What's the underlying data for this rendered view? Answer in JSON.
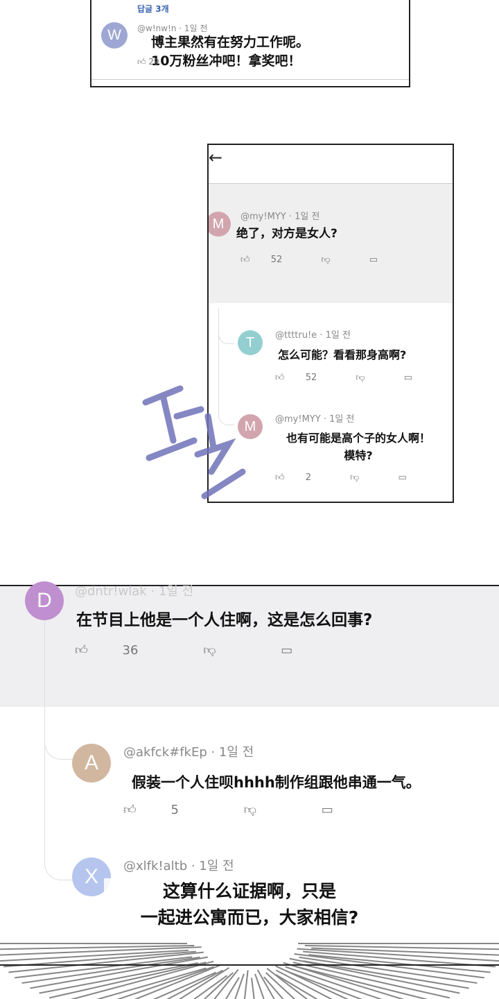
{
  "panel1": {
    "replies_link": "답글 3개",
    "avatar_letter": "W",
    "avatar_color": "#9ea7d3",
    "meta": "@w!nw!n · 1일 전",
    "text_line1": "博主果然有在努力工作呢。",
    "text_line2": "10万粉丝冲吧！拿奖吧！",
    "likes": "29"
  },
  "panel2": {
    "back_icon": "←",
    "comment": {
      "avatar_letter": "M",
      "avatar_color": "#d2a5ae",
      "meta": "@my!MYY · 1일 전",
      "text": "绝了，对方是女人?",
      "likes": "52"
    },
    "reply1": {
      "avatar_letter": "T",
      "avatar_color": "#93cfd0",
      "meta": "@ttttru!e · 1일 전",
      "text": "怎么可能？看看那身高啊?",
      "likes": "52"
    },
    "reply2": {
      "avatar_letter": "M",
      "avatar_color": "#d2a5ae",
      "meta": "@my!MYY · 1일 전",
      "text_line1": "也有可能是高个子的女人啊！",
      "text_line2": "模特?",
      "likes": "2"
    }
  },
  "panel3": {
    "comment": {
      "avatar_letter": "D",
      "avatar_color": "#bf8fd0",
      "meta": "@dntr!wlak · 1일 전",
      "text": "在节目上他是一个人住啊，这是怎么回事?",
      "likes": "36"
    },
    "reply1": {
      "avatar_letter": "A",
      "avatar_color": "#d2b7a0",
      "meta": "@akfck#fkEp · 1일 전",
      "text": "假装一个人住呗hhhh制作组跟他串通一气。",
      "likes": "5"
    },
    "reply2": {
      "avatar_letter": "X",
      "avatar_color": "#b6c5ee",
      "meta": "@xlfk!altb · 1일 전",
      "bubble_line1": "这算什么证据啊，只是",
      "bubble_line2": "一起进公寓而已，大家相信?"
    }
  }
}
